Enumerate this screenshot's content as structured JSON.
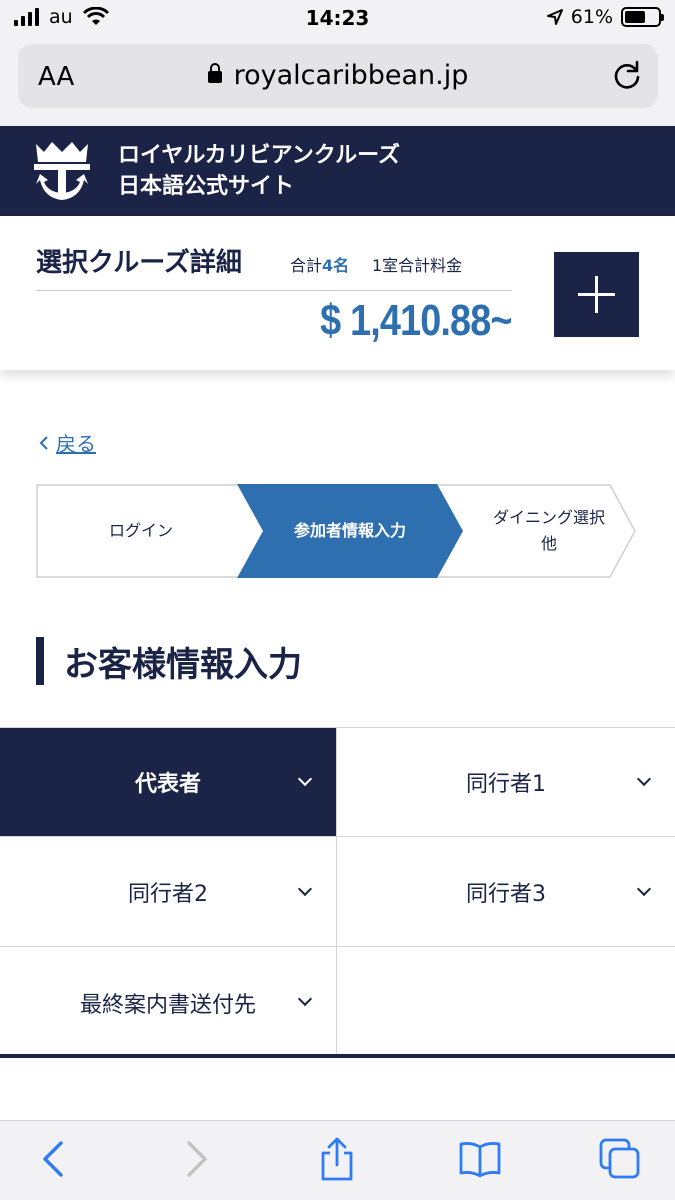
{
  "status_bar": {
    "carrier": "au",
    "time": "14:23",
    "battery": "61%"
  },
  "browser": {
    "text_size_label": "AA",
    "url": "royalcaribbean.jp"
  },
  "site": {
    "title_line1": "ロイヤルカリビアンクルーズ",
    "title_line2": "日本語公式サイト"
  },
  "summary": {
    "title": "選択クルーズ詳細",
    "count_prefix": "合計",
    "count_value": "4名",
    "price_label": "1室合計料金",
    "price": "$ 1,410.88~"
  },
  "back_link": "戻る",
  "steps": [
    {
      "label": "ログイン",
      "state": "done"
    },
    {
      "label": "参加者情報入力",
      "state": "current"
    },
    {
      "label": "ダイニング選択 他",
      "state": "upcoming"
    }
  ],
  "section_title": "お客様情報入力",
  "guest_tabs": [
    {
      "label": "代表者",
      "active": true
    },
    {
      "label": "同行者1",
      "active": false
    },
    {
      "label": "同行者2",
      "active": false
    },
    {
      "label": "同行者3",
      "active": false
    },
    {
      "label": "最終案内書送付先",
      "active": false
    }
  ],
  "colors": {
    "navy": "#1b2447",
    "accent_blue": "#2e6fb0"
  }
}
